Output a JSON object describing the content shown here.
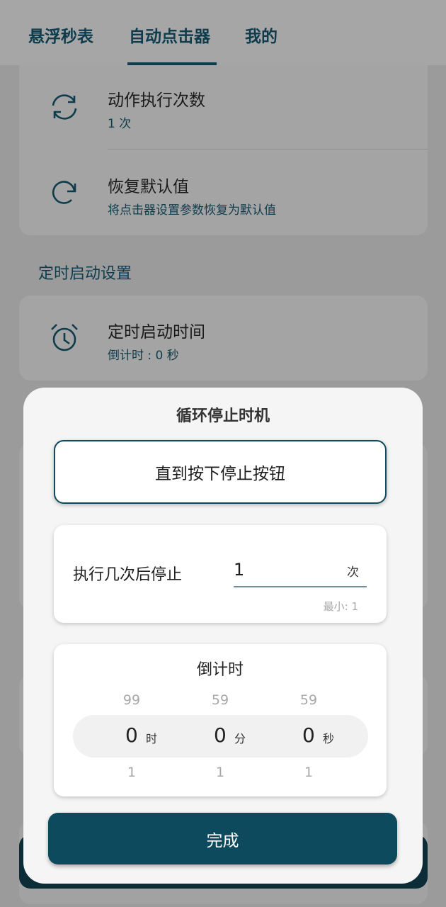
{
  "tabs": [
    "悬浮秒表",
    "自动点击器",
    "我的"
  ],
  "rows": {
    "repeat": {
      "title": "动作执行次数",
      "sub": "1 次"
    },
    "reset": {
      "title": "恢复默认值",
      "sub": "将点击器设置参数恢复为默认值"
    },
    "timer": {
      "title": "定时启动时间",
      "sub": "倒计时 : 0 秒"
    }
  },
  "section_timer": "定时启动设置",
  "dialog": {
    "title": "循环停止时机",
    "option_button": "直到按下停止按钮",
    "count_label": "执行几次后停止",
    "count_value": "1",
    "count_unit": "次",
    "count_min": "最小: 1",
    "countdown_title": "倒计时",
    "picker": [
      {
        "above": "99",
        "value": "0",
        "unit": "时",
        "below": "1"
      },
      {
        "above": "59",
        "value": "0",
        "unit": "分",
        "below": "1"
      },
      {
        "above": "59",
        "value": "0",
        "unit": "秒",
        "below": "1"
      }
    ],
    "done_button": "完成"
  },
  "colors": {
    "accent": "#0e4a5e",
    "scrim": "#9b9b9b"
  },
  "icons": {
    "repeat": "sync-icon",
    "reset": "redo-icon",
    "timer": "alarm-clock-icon"
  }
}
